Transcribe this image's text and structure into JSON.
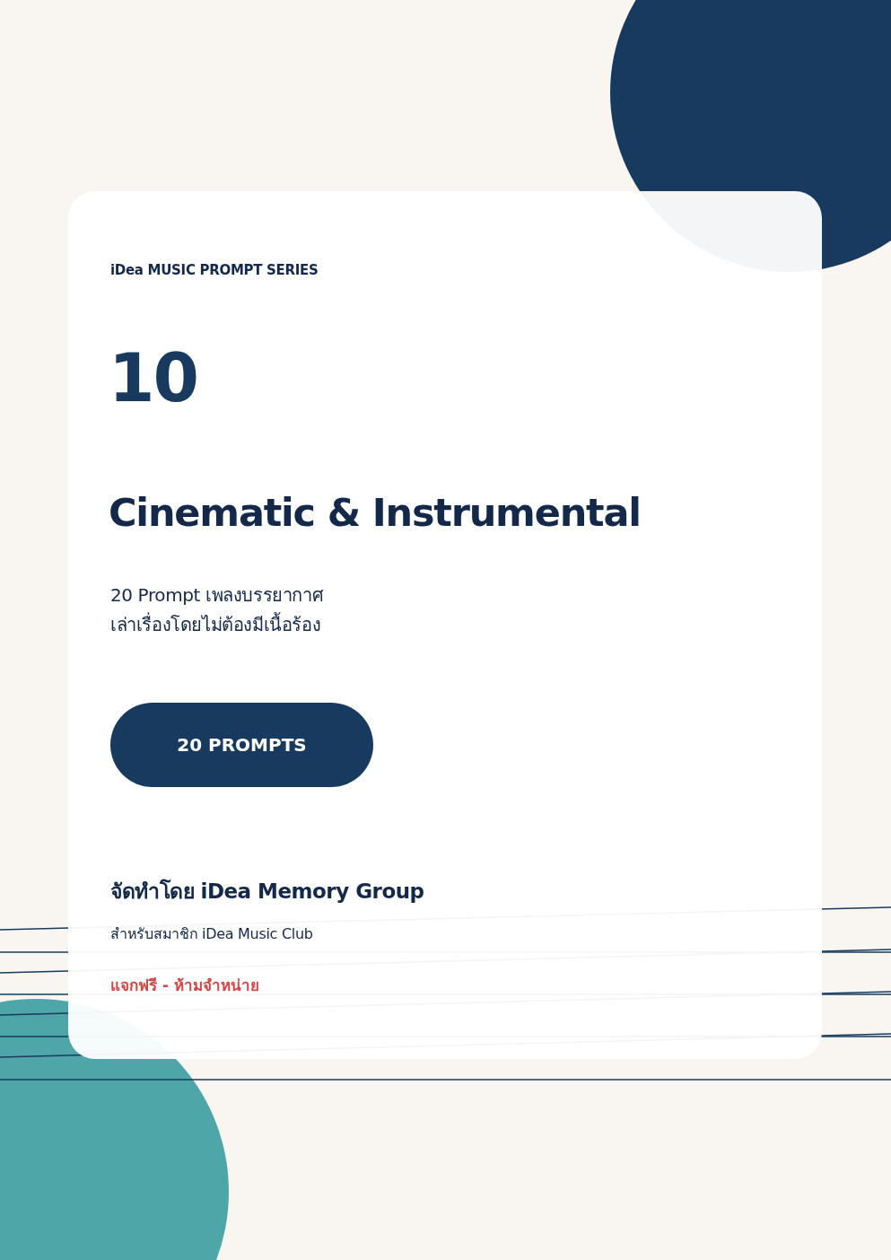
{
  "series_label": "iDea MUSIC PROMPT SERIES",
  "issue_number": "10",
  "title": "Cinematic & Instrumental",
  "description": [
    "20 Prompt เพลงบรรยากาศ",
    "เล่าเรื่องโดยไม่ต้องมีเนื้อร้อง"
  ],
  "count_badge": "20 PROMPTS",
  "credit": "จัดทำโดย iDea Memory Group",
  "audience": "สำหรับสมาชิก iDea Music Club",
  "notice": "แจกฟรี - ห้ามจำหน่าย"
}
